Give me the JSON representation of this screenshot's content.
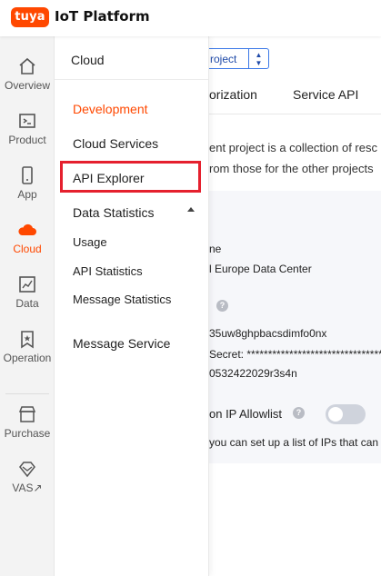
{
  "header": {
    "logo_mark": "tuya",
    "app_title": "IoT Platform"
  },
  "rail": {
    "items": [
      {
        "label": "Overview",
        "icon": "home-icon"
      },
      {
        "label": "Product",
        "icon": "terminal-icon"
      },
      {
        "label": "App",
        "icon": "phone-icon"
      },
      {
        "label": "Cloud",
        "icon": "cloud-icon",
        "active": true
      },
      {
        "label": "Data",
        "icon": "chart-icon"
      },
      {
        "label": "Operation",
        "icon": "bookmark-star-icon"
      },
      {
        "label": "Purchase",
        "icon": "shop-icon"
      },
      {
        "label": "VAS",
        "icon": "diamond-icon",
        "suffix": "↗"
      }
    ]
  },
  "flyout": {
    "title": "Cloud",
    "items": [
      {
        "label": "Development"
      },
      {
        "label": "Cloud Services"
      },
      {
        "label": "API Explorer"
      },
      {
        "label": "Data Statistics"
      },
      {
        "label": "Usage"
      },
      {
        "label": "API Statistics"
      },
      {
        "label": "Message Statistics"
      },
      {
        "label": "Message Service"
      }
    ]
  },
  "main": {
    "project_select": "roject",
    "tabs": [
      {
        "label": "orization"
      },
      {
        "label": "Service API"
      }
    ],
    "description_lines": [
      "ent project is a collection of resc",
      "rom those for the other projects"
    ],
    "details": {
      "name_label": "ne",
      "data_center": "l Europe Data Center",
      "access_id": "35uw8ghpbacsdimfo0nx",
      "secret_label": "Secret: ",
      "secret_mask": "********************************",
      "secret_value": "0532422029r3s4n",
      "ip_allowlist_label": "on IP Allowlist",
      "ip_allowlist_desc": "you can set up a list of IPs that can l",
      "ip_allowlist_enabled": false
    }
  },
  "colors": {
    "brand": "#ff4800",
    "highlight": "#e5202e",
    "link": "#3b78e7"
  }
}
